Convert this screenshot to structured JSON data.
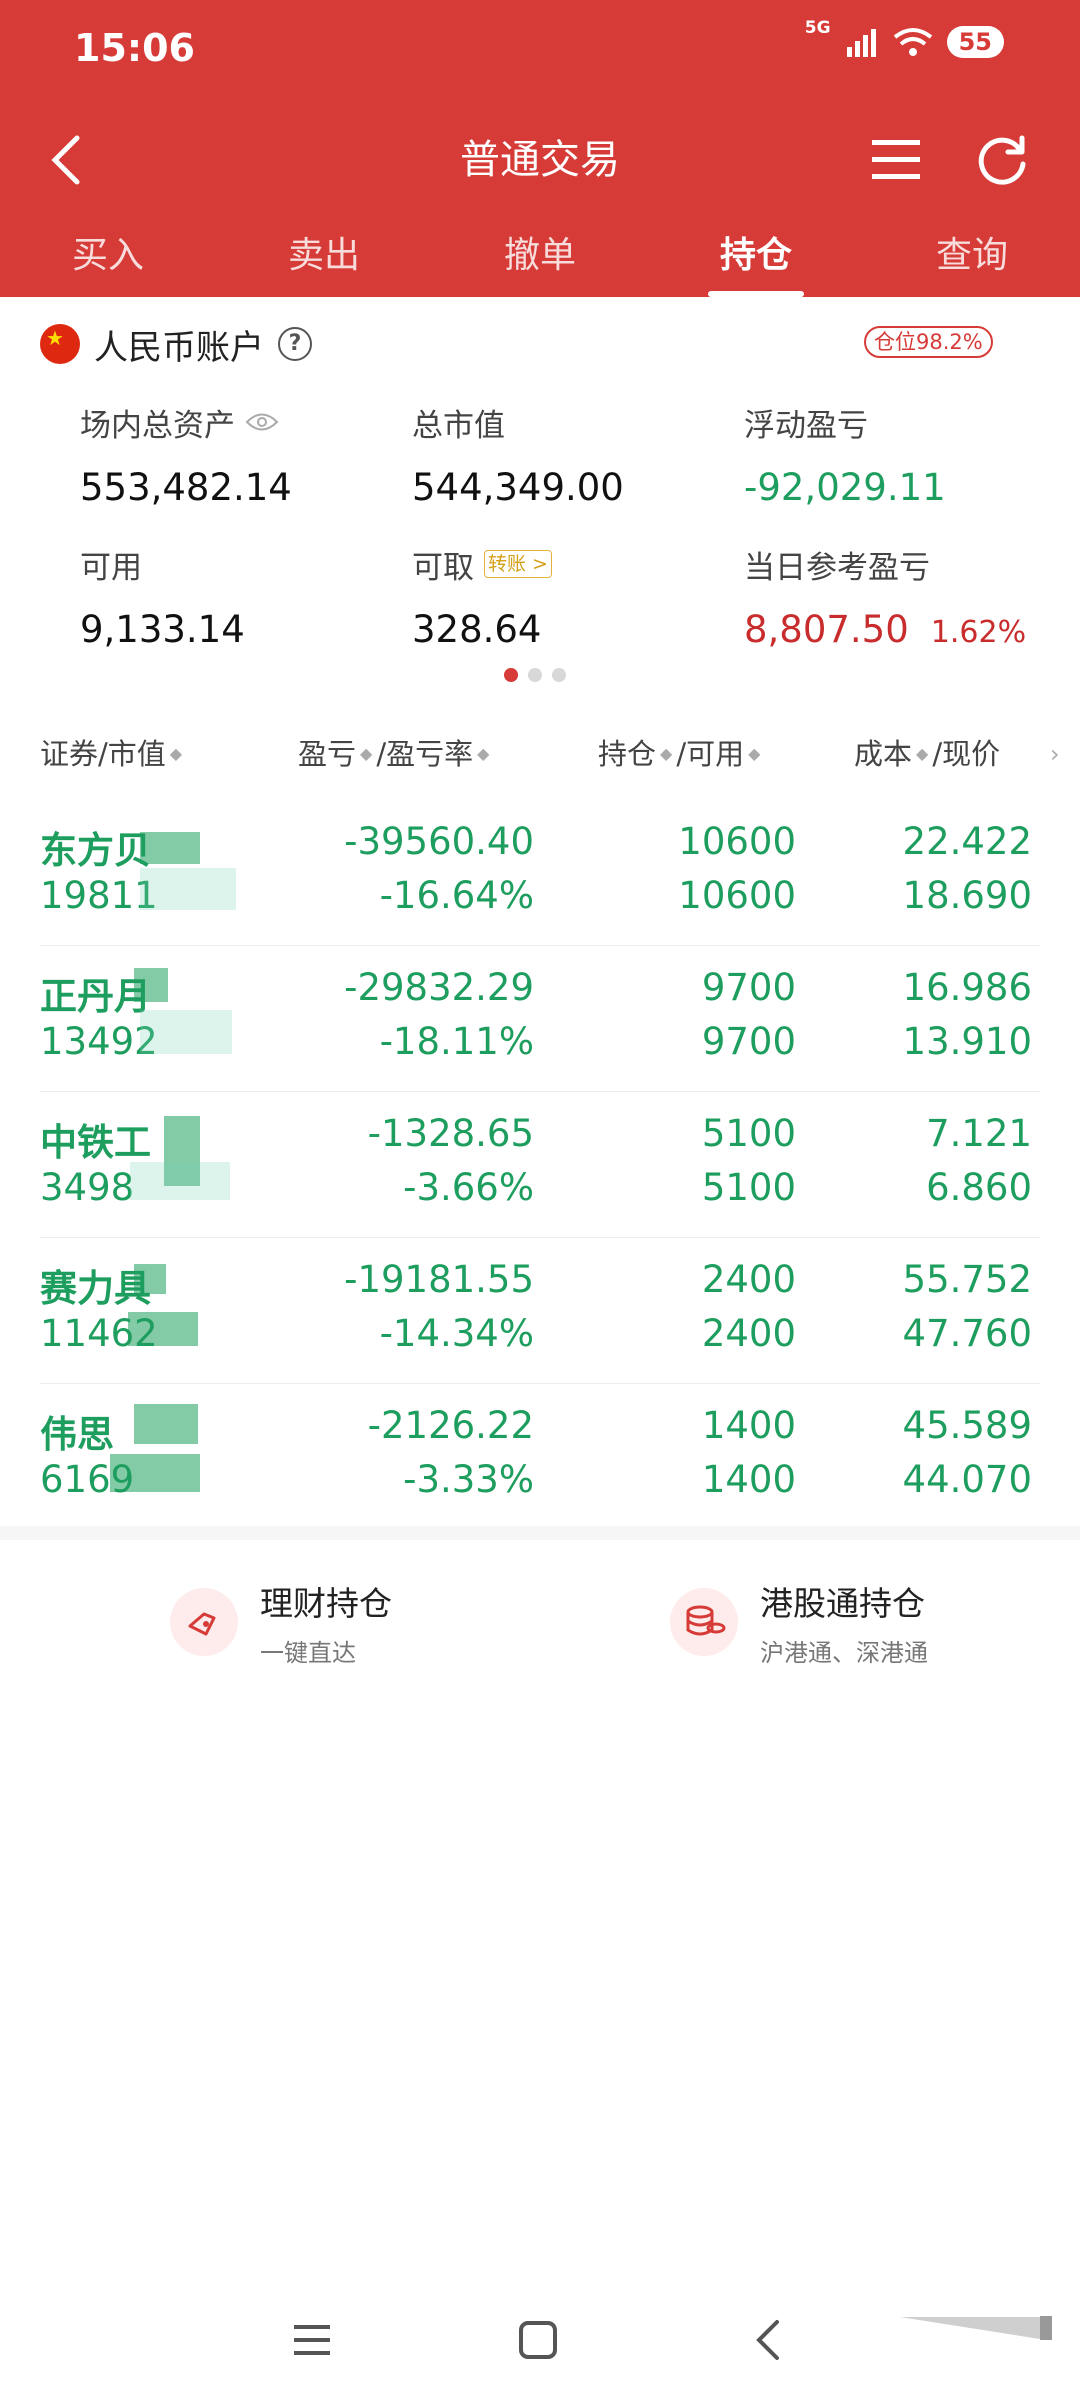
{
  "status_bar": {
    "time": "15:06",
    "network": "5G",
    "battery": "55"
  },
  "header": {
    "title": "普通交易"
  },
  "tabs": [
    {
      "label": "买入",
      "active": false
    },
    {
      "label": "卖出",
      "active": false
    },
    {
      "label": "撤单",
      "active": false
    },
    {
      "label": "持仓",
      "active": true
    },
    {
      "label": "查询",
      "active": false
    }
  ],
  "account": {
    "title": "人民币账户",
    "position_badge": "仓位98.2%",
    "total_assets_label": "场内总资产",
    "total_assets": "553,482.14",
    "market_value_label": "总市值",
    "market_value": "544,349.00",
    "floating_pl_label": "浮动盈亏",
    "floating_pl": "-92,029.11",
    "available_label": "可用",
    "available": "9,133.14",
    "withdrawable_label": "可取",
    "transfer_label": "转账 >",
    "withdrawable": "328.64",
    "daily_pl_label": "当日参考盈亏",
    "daily_pl": "8,807.50",
    "daily_pl_pct": "1.62%"
  },
  "table": {
    "columns": [
      "证券/市值",
      "盈亏",
      "/盈亏率",
      "持仓",
      "/可用",
      "成本",
      "/现价"
    ],
    "rows": [
      {
        "name": "东方贝",
        "market_value": "19811",
        "pl": "-39560.40",
        "pl_rate": "-16.64%",
        "hold": "10600",
        "avail": "10600",
        "cost": "22.422",
        "price": "18.690"
      },
      {
        "name": "正丹月",
        "market_value": "13492",
        "pl": "-29832.29",
        "pl_rate": "-18.11%",
        "hold": "9700",
        "avail": "9700",
        "cost": "16.986",
        "price": "13.910"
      },
      {
        "name": "中铁工",
        "market_value": "3498",
        "pl": "-1328.65",
        "pl_rate": "-3.66%",
        "hold": "5100",
        "avail": "5100",
        "cost": "7.121",
        "price": "6.860"
      },
      {
        "name": "赛力具",
        "market_value": "11462",
        "pl": "-19181.55",
        "pl_rate": "-14.34%",
        "hold": "2400",
        "avail": "2400",
        "cost": "55.752",
        "price": "47.760"
      },
      {
        "name": "伟思",
        "market_value": "6169",
        "pl": "-2126.22",
        "pl_rate": "-3.33%",
        "hold": "1400",
        "avail": "1400",
        "cost": "45.589",
        "price": "44.070"
      }
    ]
  },
  "quick_links": [
    {
      "title": "理财持仓",
      "subtitle": "一键直达",
      "icon": "wallet-icon"
    },
    {
      "title": "港股通持仓",
      "subtitle": "沪港通、深港通",
      "icon": "coins-icon"
    }
  ],
  "colors": {
    "brand_red": "#d63b37",
    "loss_green": "#1e9e5e",
    "gain_red": "#c92c2c"
  }
}
